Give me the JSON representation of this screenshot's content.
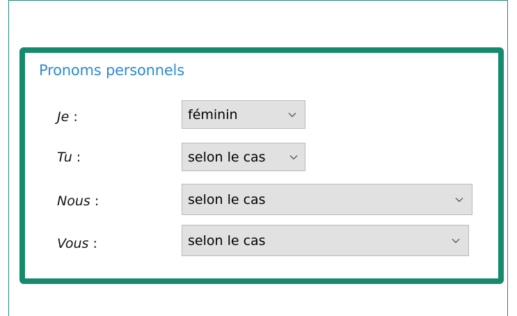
{
  "section": {
    "title": "Pronoms personnels"
  },
  "rows": [
    {
      "pronoun": "Je",
      "colon": " :",
      "value": "féminin"
    },
    {
      "pronoun": "Tu",
      "colon": " :",
      "value": "selon le cas"
    },
    {
      "pronoun": "Nous",
      "colon": " :",
      "value": "selon le cas"
    },
    {
      "pronoun": "Vous",
      "colon": " :",
      "value": "selon le cas"
    }
  ],
  "colors": {
    "frame": "#1e8a78",
    "highlight_border": "#168a6f",
    "title": "#2d8bd0",
    "select_bg": "#e1e1e1"
  },
  "icons": {
    "dropdown": "chevron-down-icon"
  }
}
